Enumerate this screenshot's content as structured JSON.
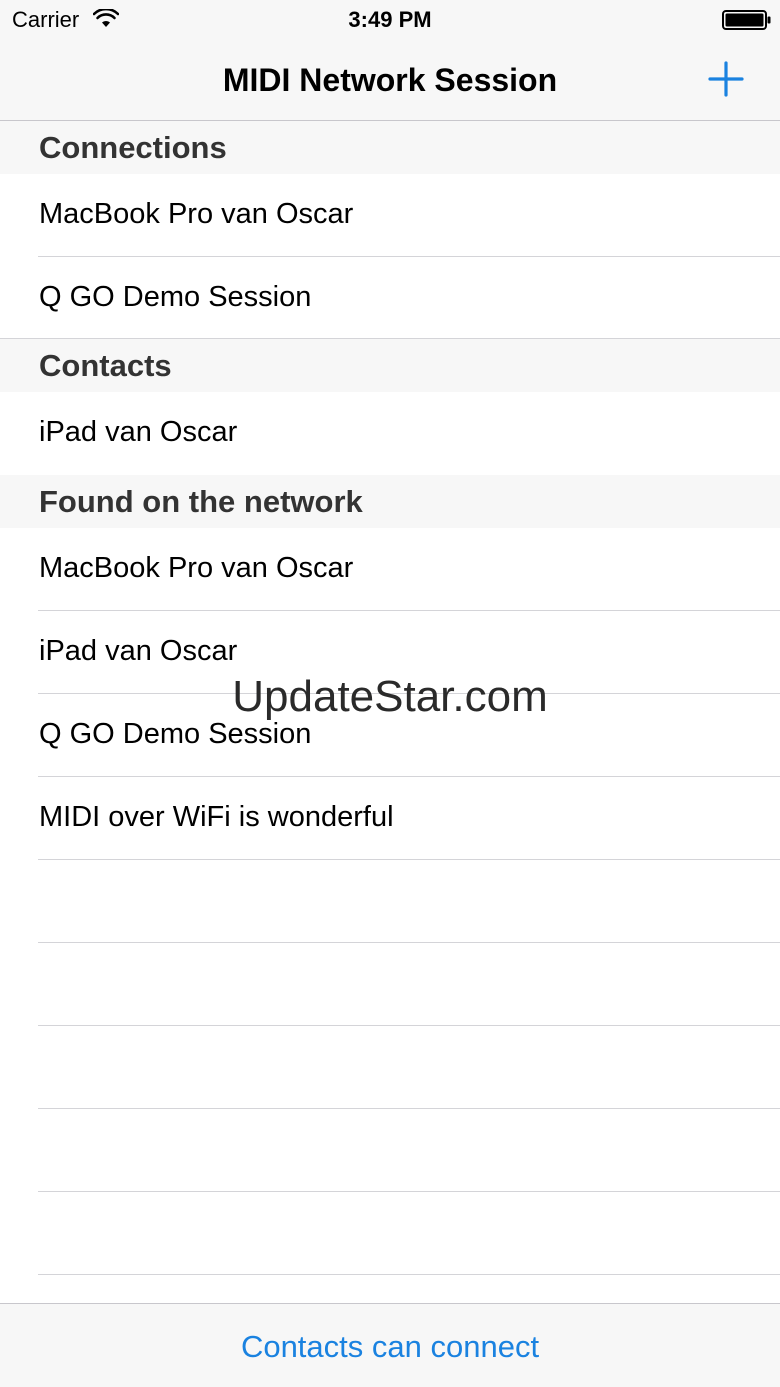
{
  "status_bar": {
    "carrier": "Carrier",
    "time": "3:49 PM",
    "wifi_icon": "wifi-icon",
    "battery_icon": "battery-icon"
  },
  "nav": {
    "title": "MIDI Network Session",
    "add_icon": "plus-icon"
  },
  "sections": {
    "connections": {
      "header": "Connections",
      "items": [
        "MacBook Pro van Oscar",
        "Q GO Demo Session"
      ]
    },
    "contacts": {
      "header": "Contacts",
      "items": [
        "iPad van Oscar"
      ]
    },
    "found": {
      "header": "Found on the network",
      "items": [
        "MacBook Pro van Oscar",
        "iPad van Oscar",
        "Q GO Demo Session",
        "MIDI over WiFi is wonderful"
      ]
    }
  },
  "watermark": "UpdateStar.com",
  "toolbar": {
    "button_label": "Contacts can connect"
  },
  "colors": {
    "accent": "#1a82e0",
    "bar_background": "#f7f7f7",
    "separator": "#d4d4d8"
  }
}
